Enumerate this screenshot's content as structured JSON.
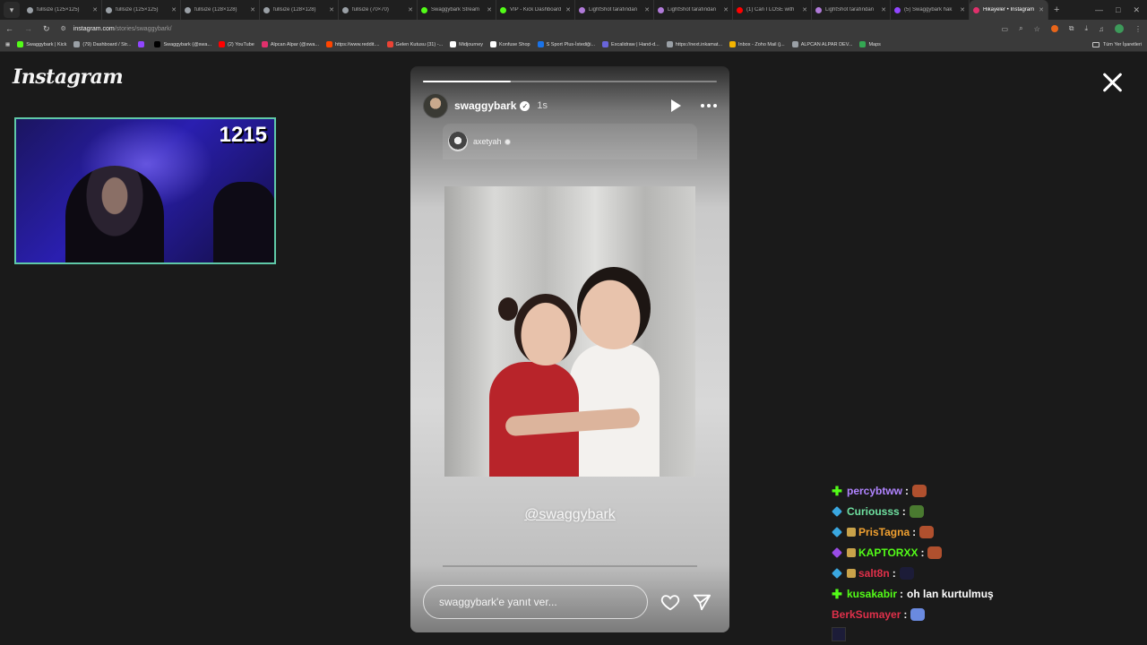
{
  "browser": {
    "tabs": [
      {
        "label": "fullsize (125×125)",
        "color": "#9aa0a6"
      },
      {
        "label": "fullsize (125×125)",
        "color": "#9aa0a6"
      },
      {
        "label": "fullsize (128×128)",
        "color": "#9aa0a6"
      },
      {
        "label": "fullsize (128×128)",
        "color": "#9aa0a6"
      },
      {
        "label": "fullsize (70×70)",
        "color": "#9aa0a6"
      },
      {
        "label": "Swaggybark Stream",
        "color": "#53fc18"
      },
      {
        "label": "VIP - Kick Dashboard",
        "color": "#53fc18"
      },
      {
        "label": "LightShot tarafından",
        "color": "#b07ad8"
      },
      {
        "label": "LightShot tarafından",
        "color": "#b07ad8"
      },
      {
        "label": "(1) Can I LOSE with",
        "color": "#ff0000"
      },
      {
        "label": "LightShot tarafından",
        "color": "#b07ad8"
      },
      {
        "label": "(5) Swaggybark hak",
        "color": "#9146ff"
      },
      {
        "label": "Hikayeler • Instagram",
        "color": "#e1306c",
        "active": true
      }
    ],
    "url_host": "instagram.com",
    "url_path": "/stories/swaggybark/",
    "bookmarks": [
      {
        "label": "Swaggybark | Kick",
        "color": "#53fc18"
      },
      {
        "label": "(79) Dashboard / Str...",
        "color": "#9aa0a6"
      },
      {
        "label": "",
        "color": "#9146ff"
      },
      {
        "label": "Swaggybark (@swa...",
        "color": "#000000"
      },
      {
        "label": "(2) YouTube",
        "color": "#ff0000"
      },
      {
        "label": "Alpcan Alpar (@swa...",
        "color": "#e1306c"
      },
      {
        "label": "https://www.reddit....",
        "color": "#ff4500"
      },
      {
        "label": "Gelen Kutusu (31) -...",
        "color": "#ea4335"
      },
      {
        "label": "Midjourney",
        "color": "#ffffff"
      },
      {
        "label": "Konfuse Shop",
        "color": "#ffffff"
      },
      {
        "label": "S Sport Plus-İstediği...",
        "color": "#1a73e8"
      },
      {
        "label": "Excalidraw | Hand-d...",
        "color": "#6965db"
      },
      {
        "label": "https://next.inkamat...",
        "color": "#9aa0a6"
      },
      {
        "label": "Inbox - Zoho Mail (j...",
        "color": "#f4b400"
      },
      {
        "label": "ALPCAN ALPAR DEV...",
        "color": "#9aa0a6"
      },
      {
        "label": "Maps",
        "color": "#34a853"
      }
    ],
    "all_bookmarks": "Tüm Yer İşaretleri"
  },
  "instagram": {
    "logo": "Instagram",
    "story": {
      "username": "swaggybark",
      "time": "1s",
      "progress": 0.3,
      "repost_username": "axetyah",
      "mention": "@swaggybark",
      "reply_placeholder": "swaggybark'e yanıt ver..."
    }
  },
  "webcam": {
    "counter": "1215"
  },
  "chat": {
    "messages": [
      {
        "user": "percybtww",
        "color": "#b084ff",
        "badge": "plus",
        "text": ""
      },
      {
        "user": "Curiousss",
        "color": "#6fe0a0",
        "badge": "cube",
        "text": ""
      },
      {
        "user": "PrisTagna",
        "color": "#f0a030",
        "badge": "cube",
        "text": ""
      },
      {
        "user": "KAPTORXX",
        "color": "#53fc18",
        "badge": "cube-purple",
        "text": ""
      },
      {
        "user": "salt8n",
        "color": "#e0304a",
        "badge": "cube",
        "text": ""
      },
      {
        "user": "kusakabir",
        "color": "#53fc18",
        "badge": "plus",
        "text": "oh lan kurtulmuş"
      },
      {
        "user": "BerkSumayer",
        "color": "#e0304a",
        "badge": "",
        "text": ""
      }
    ]
  }
}
